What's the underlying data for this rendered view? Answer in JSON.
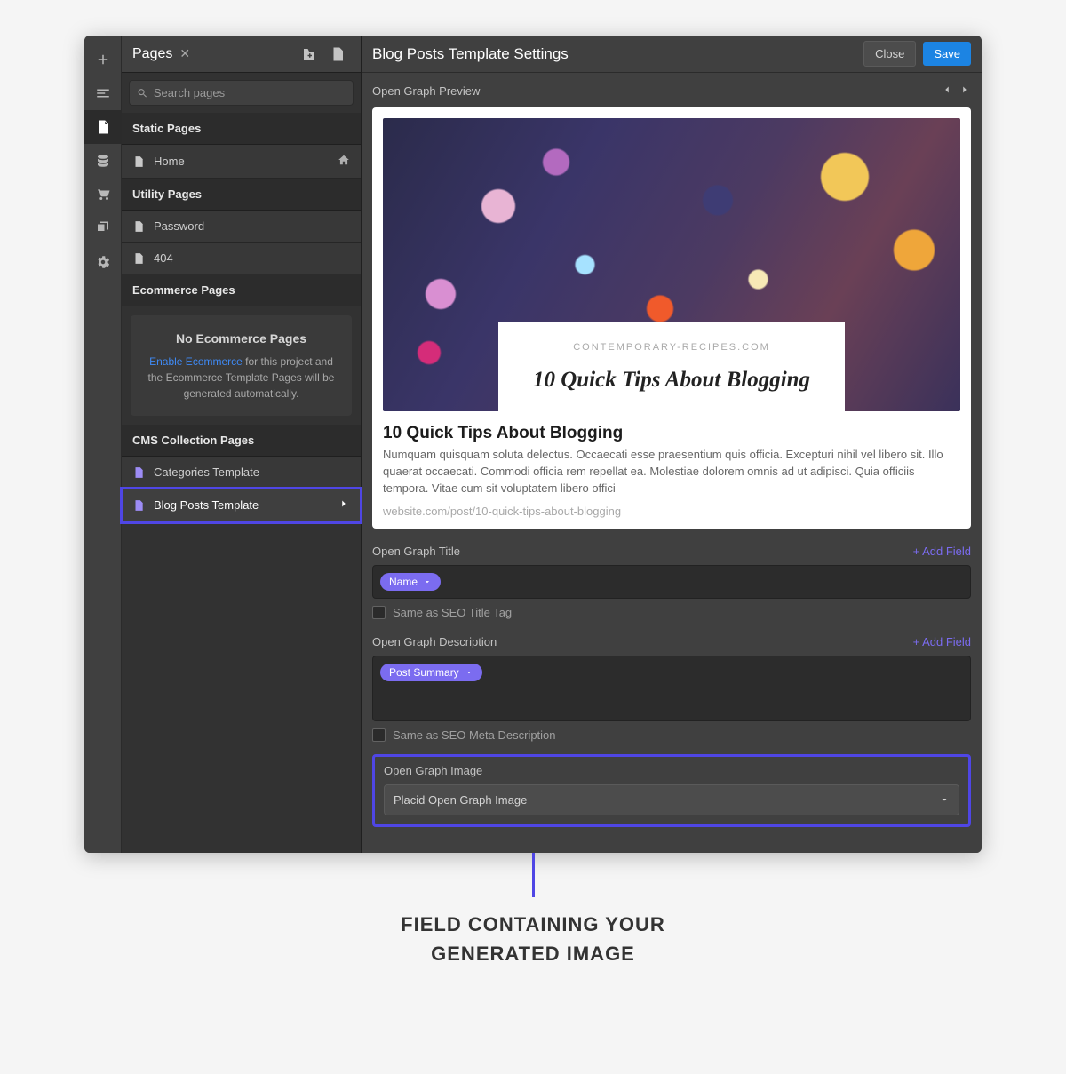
{
  "sidebar": {
    "title": "Pages",
    "search_placeholder": "Search pages",
    "sections": {
      "static": {
        "label": "Static Pages",
        "items": [
          {
            "label": "Home",
            "is_home": true
          }
        ]
      },
      "utility": {
        "label": "Utility Pages",
        "items": [
          {
            "label": "Password"
          },
          {
            "label": "404"
          }
        ]
      },
      "ecommerce": {
        "label": "Ecommerce Pages",
        "empty_title": "No Ecommerce Pages",
        "empty_link_text": "Enable Ecommerce",
        "empty_rest": " for this project and the Ecommerce Template Pages will be generated automatically."
      },
      "cms": {
        "label": "CMS Collection Pages",
        "items": [
          {
            "label": "Categories Template"
          },
          {
            "label": "Blog Posts Template",
            "active": true
          }
        ]
      }
    }
  },
  "main": {
    "title": "Blog Posts Template Settings",
    "close_label": "Close",
    "save_label": "Save",
    "og_preview_label": "Open Graph Preview",
    "preview": {
      "domain": "CONTEMPORARY-RECIPES.COM",
      "headline": "10 Quick Tips About Blogging",
      "title": "10 Quick Tips About Blogging",
      "description": "Numquam quisquam soluta delectus. Occaecati esse praesentium quis officia. Excepturi nihil vel libero sit. Illo quaerat occaecati. Commodi officia rem repellat ea. Molestiae dolorem omnis ad ut adipisci. Quia officiis tempora. Vitae cum sit voluptatem libero offici",
      "url": "website.com/post/10-quick-tips-about-blogging"
    },
    "og_title": {
      "label": "Open Graph Title",
      "add_label": "+ Add Field",
      "chip": "Name",
      "checkbox_label": "Same as SEO Title Tag"
    },
    "og_description": {
      "label": "Open Graph Description",
      "add_label": "+ Add Field",
      "chip": "Post Summary",
      "checkbox_label": "Same as SEO Meta Description"
    },
    "og_image": {
      "label": "Open Graph Image",
      "value": "Placid Open Graph Image"
    }
  },
  "callout": {
    "line1": "FIELD CONTAINING YOUR",
    "line2": "GENERATED IMAGE"
  }
}
